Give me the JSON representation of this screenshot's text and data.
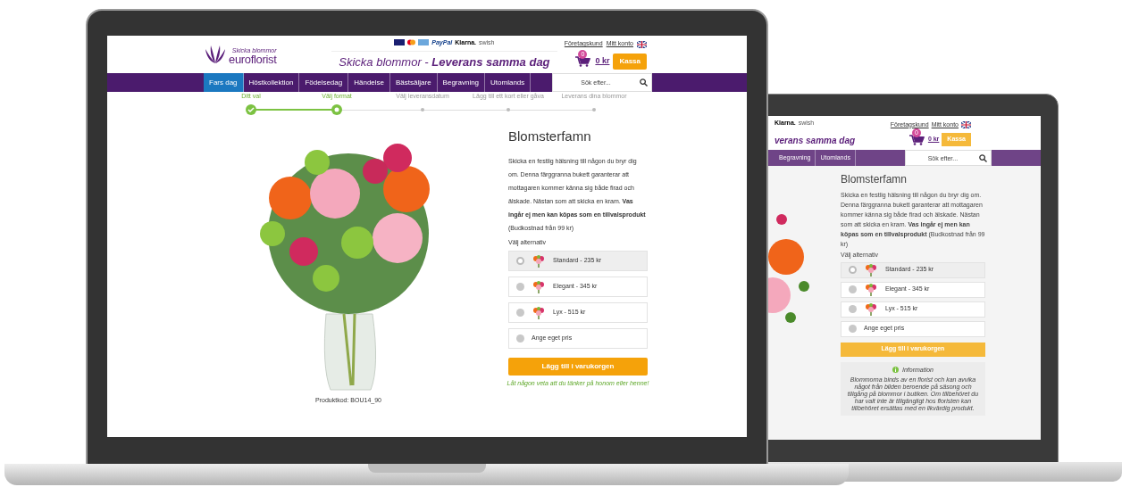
{
  "main_laptop": {
    "header": {
      "logo": {
        "tagline": "Skicka blommor",
        "name": "euroflorist"
      },
      "payments": [
        "PayPal",
        "Klarna.",
        "swish"
      ],
      "slogan": "Skicka blommor - **Leverans samma dag**",
      "top_links": [
        "Företagskund",
        "Mitt konto"
      ],
      "cart": {
        "count": "0",
        "total": "0 kr"
      },
      "checkout_button": "Kassa"
    },
    "nav": [
      {
        "label": "Fars dag",
        "selected": true
      },
      {
        "label": "Höstkollektion",
        "selected": false
      },
      {
        "label": "Födelsedag",
        "selected": false
      },
      {
        "label": "Händelse",
        "selected": false
      },
      {
        "label": "Bästsäljare",
        "selected": false
      },
      {
        "label": "Begravning",
        "selected": false
      },
      {
        "label": "Utomlands",
        "selected": false
      }
    ],
    "search": {
      "placeholder": "Sök efter..."
    },
    "steps": [
      {
        "label": "Ditt val",
        "done": true,
        "current": false
      },
      {
        "label": "Välj format",
        "done": true,
        "current": true
      },
      {
        "label": "Välj leveransdatum",
        "done": false,
        "current": false
      },
      {
        "label": "Lägg till ett kort eller gåva",
        "done": false,
        "current": false
      },
      {
        "label": "Leverans dina blommor",
        "done": false,
        "current": false
      }
    ],
    "product": {
      "title": "Blomsterfamn",
      "description": "Skicka en festlig hälsning till någon du bryr dig om. Denna färggranna bukett garanterar att mottagaren kommer känna sig både firad och älskade. Nästan som att skicka en kram. **Vas ingår ej men kan köpas som en tillvalsprodukt** (Budkostnad från 99 kr)",
      "options_label": "Välj alternativ",
      "options": [
        {
          "kind": "image",
          "label": "Standard -  235 kr",
          "selected": true
        },
        {
          "kind": "image",
          "label": "Elegant -  345 kr",
          "selected": false
        },
        {
          "kind": "image",
          "label": "Lyx -  515 kr",
          "selected": false
        },
        {
          "kind": "plain",
          "label": "Ange eget pris",
          "selected": false
        }
      ],
      "add_button": "Lägg till i varukorgen",
      "tagline": "Låt någon veta att du tänker på honom eller henne!",
      "product_code": "Produktkod: BOU14_90"
    }
  },
  "second_laptop": {
    "header": {
      "payments": [
        "Klarna.",
        "swish"
      ],
      "slogan": "verans samma dag",
      "top_links": [
        "Företagskund",
        "Mitt konto"
      ],
      "cart": {
        "count": "0",
        "total": "0 kr"
      },
      "checkout_button": "Kassa"
    },
    "nav": [
      {
        "label": "Begravning",
        "selected": false
      },
      {
        "label": "Utomlands",
        "selected": false
      }
    ],
    "search": {
      "placeholder": "Sök efter..."
    },
    "product": {
      "title": "Blomsterfamn",
      "description": "Skicka en festlig hälsning till någon du bryr dig om. Denna färggranna bukett garanterar att mottagaren kommer känna sig både firad och älskade. Nästan som att skicka en kram. **Vas ingår ej men kan köpas som en tillvalsprodukt** (Budkostnad från 99 kr)",
      "options_label": "Välj alternativ",
      "options": [
        {
          "kind": "image",
          "label": "Standard -  235 kr",
          "selected": true
        },
        {
          "kind": "image",
          "label": "Elegant -  345 kr",
          "selected": false
        },
        {
          "kind": "image",
          "label": "Lyx -  515 kr",
          "selected": false
        },
        {
          "kind": "plain",
          "label": "Ange eget pris",
          "selected": false
        }
      ],
      "add_button": "Lägg till i varukorgen",
      "info": {
        "title": "Information",
        "text": "Blommorna binds av en florist och kan avvika något från bilden beroende på säsong och tillgång på blommor i butiken. Om tillbehöret du har valt inte är tillgängligt hos floristen kan tillbehöret ersättas med en likvärdig produkt."
      }
    }
  }
}
